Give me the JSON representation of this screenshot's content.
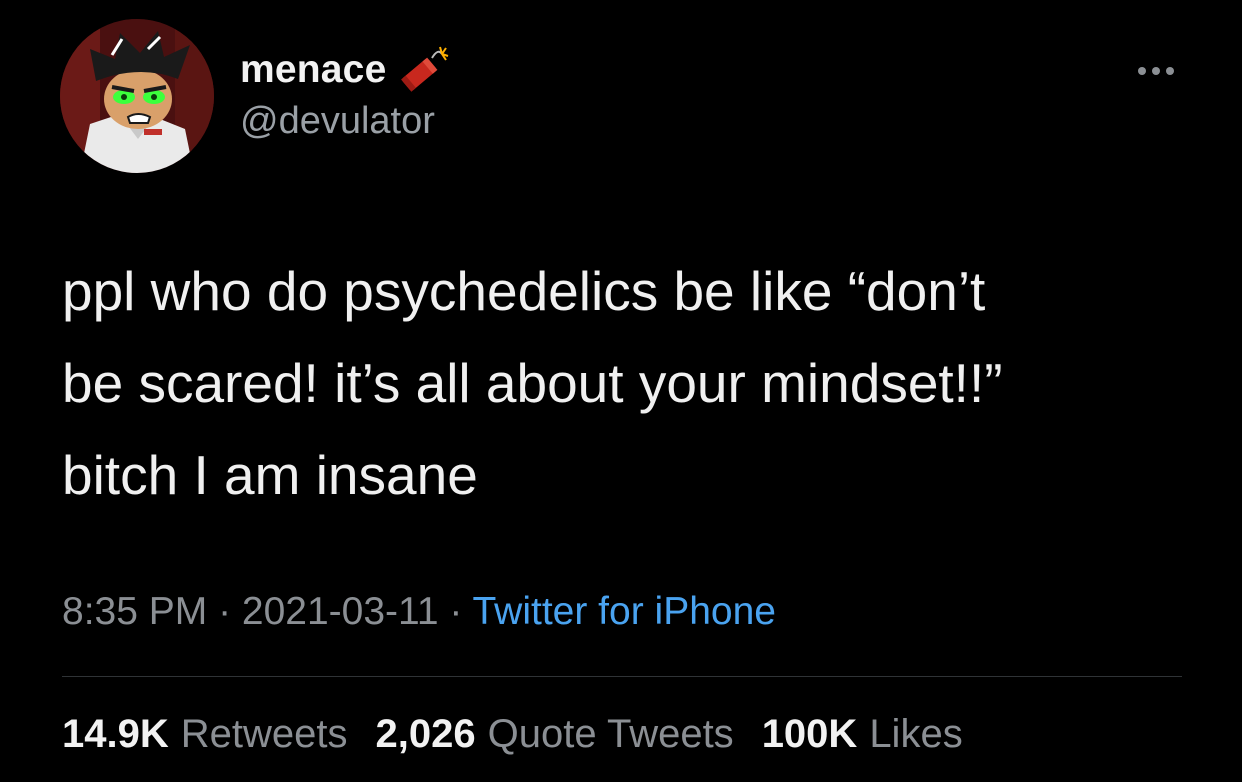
{
  "author": {
    "display_name": "menace",
    "name_emoji": "firecracker-icon",
    "handle": "@devulator",
    "avatar_icon": "cartoon-character-avatar"
  },
  "tweet": {
    "lines": [
      "ppl who do psychedelics be like “don’t",
      "be scared! it’s all about your mindset!!”",
      "bitch I am insane"
    ]
  },
  "meta": {
    "time": "8:35 PM",
    "separator": "·",
    "date": "2021-03-11",
    "source": "Twitter for iPhone"
  },
  "stats": {
    "retweets_count": "14.9K",
    "retweets_label": "Retweets",
    "quotes_count": "2,026",
    "quotes_label": "Quote Tweets",
    "likes_count": "100K",
    "likes_label": "Likes"
  },
  "colors": {
    "background": "#000000",
    "text": "#f0f0f0",
    "secondary": "#8b8f94",
    "link": "#4aa3f0"
  }
}
